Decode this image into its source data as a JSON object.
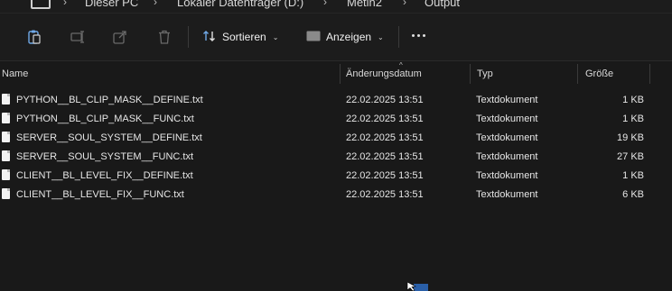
{
  "breadcrumb": {
    "items": [
      "Dieser PC",
      "Lokaler Datenträger (D:)",
      "Metin2",
      "Output"
    ]
  },
  "toolbar": {
    "sort_label": "Sortieren",
    "view_label": "Anzeigen",
    "icons": [
      "paste-icon",
      "rename-icon",
      "share-icon",
      "delete-icon",
      "sort-icon",
      "view-icon",
      "more-icon"
    ]
  },
  "columns": {
    "name": "Name",
    "date": "Änderungsdatum",
    "type": "Typ",
    "size": "Größe"
  },
  "files": [
    {
      "name": "PYTHON__BL_CLIP_MASK__DEFINE.txt",
      "date": "22.02.2025 13:51",
      "type": "Textdokument",
      "size": "1 KB"
    },
    {
      "name": "PYTHON__BL_CLIP_MASK__FUNC.txt",
      "date": "22.02.2025 13:51",
      "type": "Textdokument",
      "size": "1 KB"
    },
    {
      "name": "SERVER__SOUL_SYSTEM__DEFINE.txt",
      "date": "22.02.2025 13:51",
      "type": "Textdokument",
      "size": "19 KB"
    },
    {
      "name": "SERVER__SOUL_SYSTEM__FUNC.txt",
      "date": "22.02.2025 13:51",
      "type": "Textdokument",
      "size": "27 KB"
    },
    {
      "name": "CLIENT__BL_LEVEL_FIX__DEFINE.txt",
      "date": "22.02.2025 13:51",
      "type": "Textdokument",
      "size": "1 KB"
    },
    {
      "name": "CLIENT__BL_LEVEL_FIX__FUNC.txt",
      "date": "22.02.2025 13:51",
      "type": "Textdokument",
      "size": "6 KB"
    }
  ],
  "colors": {
    "background": "#191919",
    "text": "#e6e6e6",
    "accent": "#2a5fa8"
  }
}
